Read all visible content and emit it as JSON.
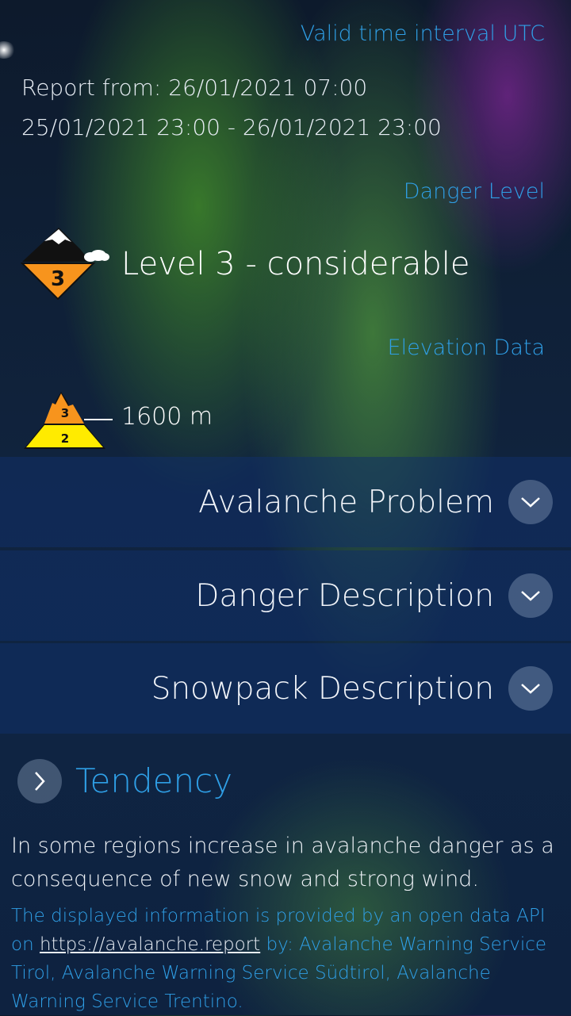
{
  "header": {
    "valid_label": "Valid time interval UTC"
  },
  "report": {
    "report_from": "Report from: 26/01/2021 07:00",
    "interval": "25/01/2021 23:00 - 26/01/2021 23:00"
  },
  "danger": {
    "section_label": "Danger Level",
    "icon_number": "3",
    "level_text": "Level 3 - considerable"
  },
  "elevation": {
    "section_label": "Elevation Data",
    "upper_level": "3",
    "lower_level": "2",
    "value": "1600 m"
  },
  "sections": [
    {
      "label": "Avalanche Problem"
    },
    {
      "label": "Danger Description"
    },
    {
      "label": "Snowpack Description"
    }
  ],
  "tendency": {
    "title": "Tendency",
    "text": "In some regions increase in avalanche danger as a consequence of new snow and strong wind."
  },
  "attribution": {
    "before_link": "The displayed information is provided by an open data API on ",
    "link": "https://avalanche.report",
    "after_link": " by: Avalanche Warning Service Tirol, Avalanche Warning Service Südtirol, Avalanche Warning Service Trentino."
  },
  "colors": {
    "accent": "#2f9fe6",
    "danger_orange": "#f7941d",
    "danger_yellow": "#ffeb00"
  }
}
